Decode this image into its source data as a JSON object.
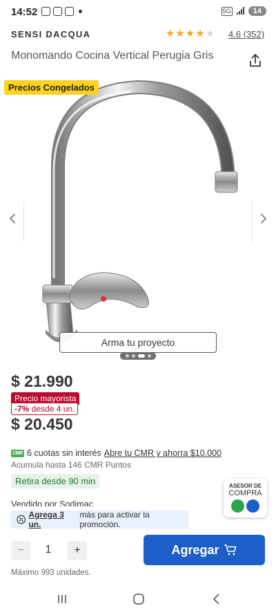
{
  "status_bar": {
    "time": "14:52",
    "battery": "14",
    "signal_text": "5G"
  },
  "header": {
    "brand": "SENSI DACQUA",
    "rating": "4.6 (352)",
    "stars_filled": 4,
    "star_color": "#f5a623",
    "title": "Monomando Cocina Vertical Perugia Gris"
  },
  "gallery": {
    "badge": "Precios Congelados",
    "proyecto_button": "Arma tu proyecto"
  },
  "pricing": {
    "price": "$ 21.990",
    "wholesale_label": "Precio mayorista",
    "wholesale_discount": "-7%",
    "wholesale_condition": " desde 4 un.",
    "wholesale_price": "$ 20.450",
    "accent_red": "#bb0a2d"
  },
  "cmr": {
    "logo": "CMR",
    "installments": "6 cuotas sin interés",
    "link": "Abre tu CMR y ahorra $10.000",
    "points": "Acumula hasta 146 CMR Puntos"
  },
  "pickup": "Retira desde 90 min",
  "seller": "Vendido por  Sodimac",
  "promo": {
    "link": "Agrega 3 un.",
    "text": "más para activar la promoción."
  },
  "asesor": {
    "line1": "ASESOR DE",
    "line2": "COMPRA"
  },
  "purchase": {
    "minus": "−",
    "quantity": "1",
    "plus": "+",
    "add_label": "Agregar",
    "max_units": "Máximo 993 unidades.",
    "primary_color": "#1d5fc9"
  }
}
